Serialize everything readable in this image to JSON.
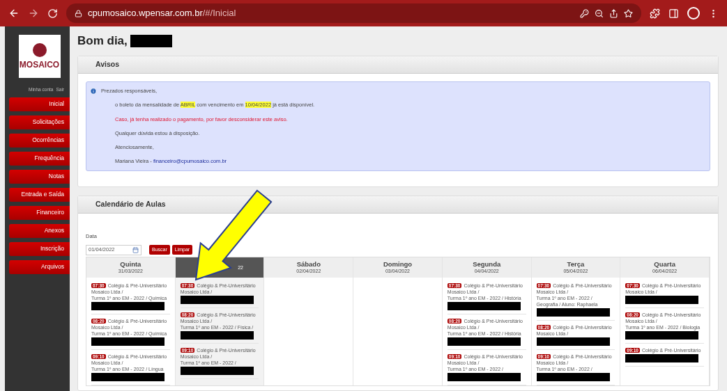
{
  "browser": {
    "url_host": "cpumosaico.wpensar.com.br",
    "url_path": "/#/Inicial"
  },
  "sidebar": {
    "logo": "MOSAICO",
    "account_links": [
      "Minha conta",
      "Sair"
    ],
    "items": [
      "Inicial",
      "Solicitações",
      "Ocorrências",
      "Frequência",
      "Notas",
      "Entrada e Saída",
      "Financeiro",
      "Anexos",
      "Inscrição",
      "Arquivos"
    ]
  },
  "greeting": "Bom dia,",
  "avisos": {
    "title": "Avisos",
    "lines": [
      {
        "kind": "heading",
        "text": "Prezados responsáveis,"
      },
      {
        "kind": "body",
        "parts": [
          {
            "text": "o boleto da mensalidade de ",
            "highlighted": false
          },
          {
            "text": "ABRIL",
            "highlighted": true
          },
          {
            "text": " com vencimento em ",
            "highlighted": false
          },
          {
            "text": "10/04/2022",
            "highlighted": true
          },
          {
            "text": " já está disponível.",
            "highlighted": false
          }
        ]
      },
      {
        "kind": "warning",
        "text": "Caso, já tenha realizado o pagamento, por favor desconsiderar este aviso."
      },
      {
        "kind": "plain",
        "text": "Qualquer dúvida estou à disposição."
      },
      {
        "kind": "plain",
        "text": "Atenciosamente,"
      },
      {
        "kind": "signature",
        "text": "Mariana Vieira - ",
        "link": "financeiro@cpumosaico.com.br"
      }
    ]
  },
  "calendar": {
    "title": "Calendário de Aulas",
    "date_label": "Data",
    "date_value": "01/04/2022",
    "buttons": [
      "Buscar",
      "Limpar"
    ],
    "days": [
      {
        "day": "Quinta",
        "date": "31/03/2022",
        "selected": false,
        "events": [
          {
            "time": "07:30",
            "school": "Colégio & Pré-Universitário",
            "lines": [
              "Mosaico Ltda /",
              "Turma 1º ano EM - 2022 / Química"
            ]
          },
          {
            "time": "08:20",
            "school": "Colégio & Pré-Universitário",
            "lines": [
              "Mosaico Ltda /",
              "Turma 1º ano EM - 2022 / Química"
            ]
          },
          {
            "time": "09:10",
            "school": "Colégio & Pré-Universitário",
            "lines": [
              "Mosaico Ltda /",
              "Turma 1º ano EM - 2022 / Língua"
            ]
          }
        ]
      },
      {
        "date": "22",
        "selected": true,
        "events": [
          {
            "time": "07:30",
            "school": "Colégio & Pré-Universitário",
            "lines": [
              "Mosaico Ltda /"
            ]
          },
          {
            "time": "08:20",
            "school": "Colégio & Pré-Universitário",
            "lines": [
              "Mosaico Ltda /",
              "Turma 1º ano EM - 2022 / Física /"
            ]
          },
          {
            "time": "09:10",
            "school": "Colégio & Pré-Universitário",
            "lines": [
              "Mosaico Ltda /",
              "Turma 1º ano EM - 2022 /"
            ]
          }
        ]
      },
      {
        "day": "Sábado",
        "date": "02/04/2022",
        "selected": false
      },
      {
        "day": "Domingo",
        "date": "03/04/2022",
        "selected": false
      },
      {
        "day": "Segunda",
        "date": "04/04/2022",
        "selected": false,
        "events": [
          {
            "time": "07:30",
            "school": "Colégio & Pré-Universitário",
            "lines": [
              "Mosaico Ltda /",
              "Turma 1º ano EM - 2022 / História"
            ]
          },
          {
            "time": "08:20",
            "school": "Colégio & Pré-Universitário",
            "lines": [
              "Mosaico Ltda /",
              "Turma 1º ano EM - 2022 / História"
            ]
          },
          {
            "time": "09:10",
            "school": "Colégio & Pré-Universitário",
            "lines": [
              "Mosaico Ltda /",
              "Turma 1º ano EM - 2022 /"
            ]
          }
        ]
      },
      {
        "day": "Terça",
        "date": "05/04/2022",
        "selected": false,
        "events": [
          {
            "time": "07:30",
            "school": "Colégio & Pré-Universitário",
            "lines": [
              "Mosaico Ltda /",
              "Turma 1º ano EM - 2022 /",
              "Geografia / Aluno: Raphaela"
            ]
          },
          {
            "time": "08:20",
            "school": "Colégio & Pré-Universitário",
            "lines": [
              "Mosaico Ltda /"
            ]
          },
          {
            "time": "09:10",
            "school": "Colégio & Pré-Universitário",
            "lines": [
              "Mosaico Ltda /",
              "Turma 1º ano EM - 2022 /"
            ]
          }
        ]
      },
      {
        "day": "Quarta",
        "date": "06/04/2022",
        "selected": false,
        "events": [
          {
            "time": "07:30",
            "school": "Colégio & Pré-Universitário",
            "lines": [
              "Mosaico Ltda /"
            ]
          },
          {
            "time": "08:20",
            "school": "Colégio & Pré-Universitário",
            "lines": [
              "Mosaico Ltda /",
              "Turma 1º ano EM - 2022 / Biologia"
            ]
          },
          {
            "time": "09:10",
            "school": "Colégio & Pré-Universitário"
          }
        ]
      }
    ]
  }
}
